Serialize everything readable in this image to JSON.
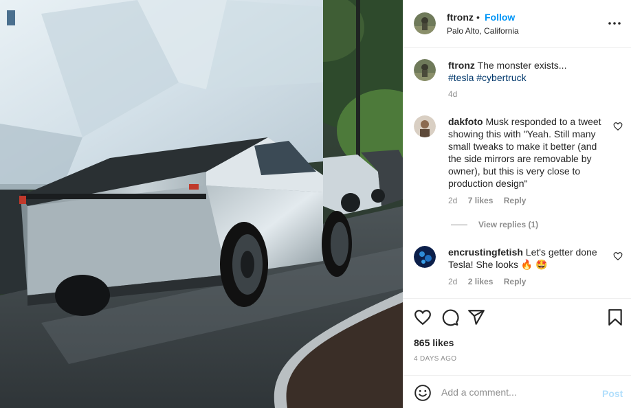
{
  "post": {
    "username": "ftronz",
    "separator": "•",
    "follow_label": "Follow",
    "location": "Palo Alto, California",
    "more_icon": "more-horizontal-icon",
    "photo_alt": "Tesla Cybertruck parked on street"
  },
  "caption": {
    "username": "ftronz",
    "text": "The monster exists...",
    "hashtags": [
      "#tesla",
      "#cybertruck"
    ],
    "time": "4d"
  },
  "comments": [
    {
      "username": "dakfoto",
      "text": "Musk responded to a tweet showing this with \"Yeah. Still many small tweaks to make it better (and the side mirrors are removable by owner), but this is very close to production design\"",
      "time": "2d",
      "likes": "7 likes",
      "reply_label": "Reply",
      "view_replies": "View replies (1)"
    },
    {
      "username": "encrustingfetish",
      "text": "Let's getter done Tesla! She looks",
      "emojis": [
        "🔥",
        "🤩"
      ],
      "time": "2d",
      "likes": "2 likes",
      "reply_label": "Reply"
    }
  ],
  "actions": {
    "icons": [
      "heart-icon",
      "comment-icon",
      "share-icon",
      "bookmark-icon"
    ],
    "likes": "865 likes",
    "posted": "4 DAYS AGO"
  },
  "composer": {
    "placeholder": "Add a comment...",
    "post_label": "Post",
    "emoji_icon": "emoji-icon"
  },
  "colors": {
    "link_blue": "#0095f6",
    "hashtag": "#00376b",
    "muted": "#8e8e8e",
    "post_disabled": "#b2dffc"
  }
}
